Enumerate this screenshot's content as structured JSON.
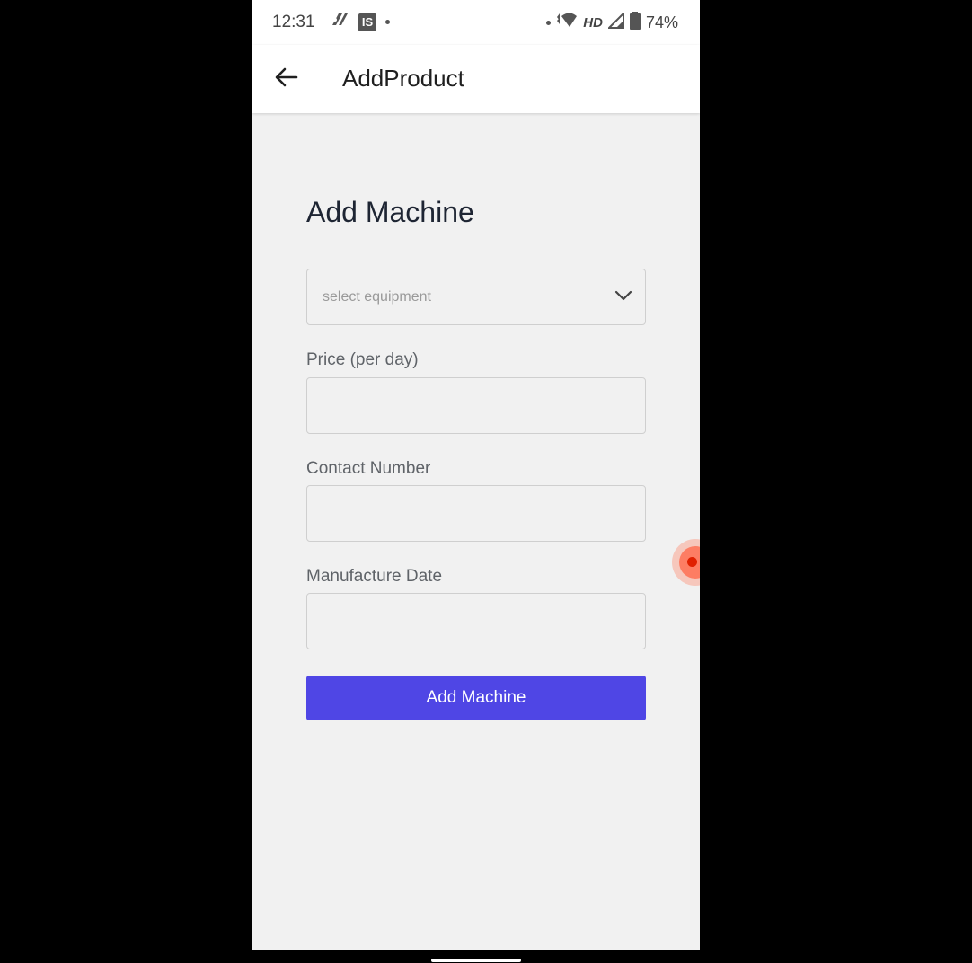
{
  "status_bar": {
    "time": "12:31",
    "is_badge": "IS",
    "network_label": "HD",
    "battery": "74%",
    "icons": [
      "app-notification-icon",
      "is-app-icon",
      "dot-icon",
      "dot-icon",
      "wifi-icon",
      "signal-icon",
      "battery-icon"
    ]
  },
  "app_bar": {
    "title": "AddProduct",
    "back_icon": "arrow-left-icon"
  },
  "form": {
    "title": "Add Machine",
    "equipment_select": {
      "placeholder": "select equipment",
      "icon": "chevron-down-icon"
    },
    "price": {
      "label": "Price (per day)",
      "value": ""
    },
    "contact": {
      "label": "Contact Number",
      "value": ""
    },
    "manufacture_date": {
      "label": "Manufacture Date",
      "value": ""
    },
    "submit_label": "Add Machine"
  },
  "colors": {
    "primary": "#4f46e5",
    "background": "#f1f1f1",
    "appbar": "#ffffff",
    "frame": "#000000"
  }
}
